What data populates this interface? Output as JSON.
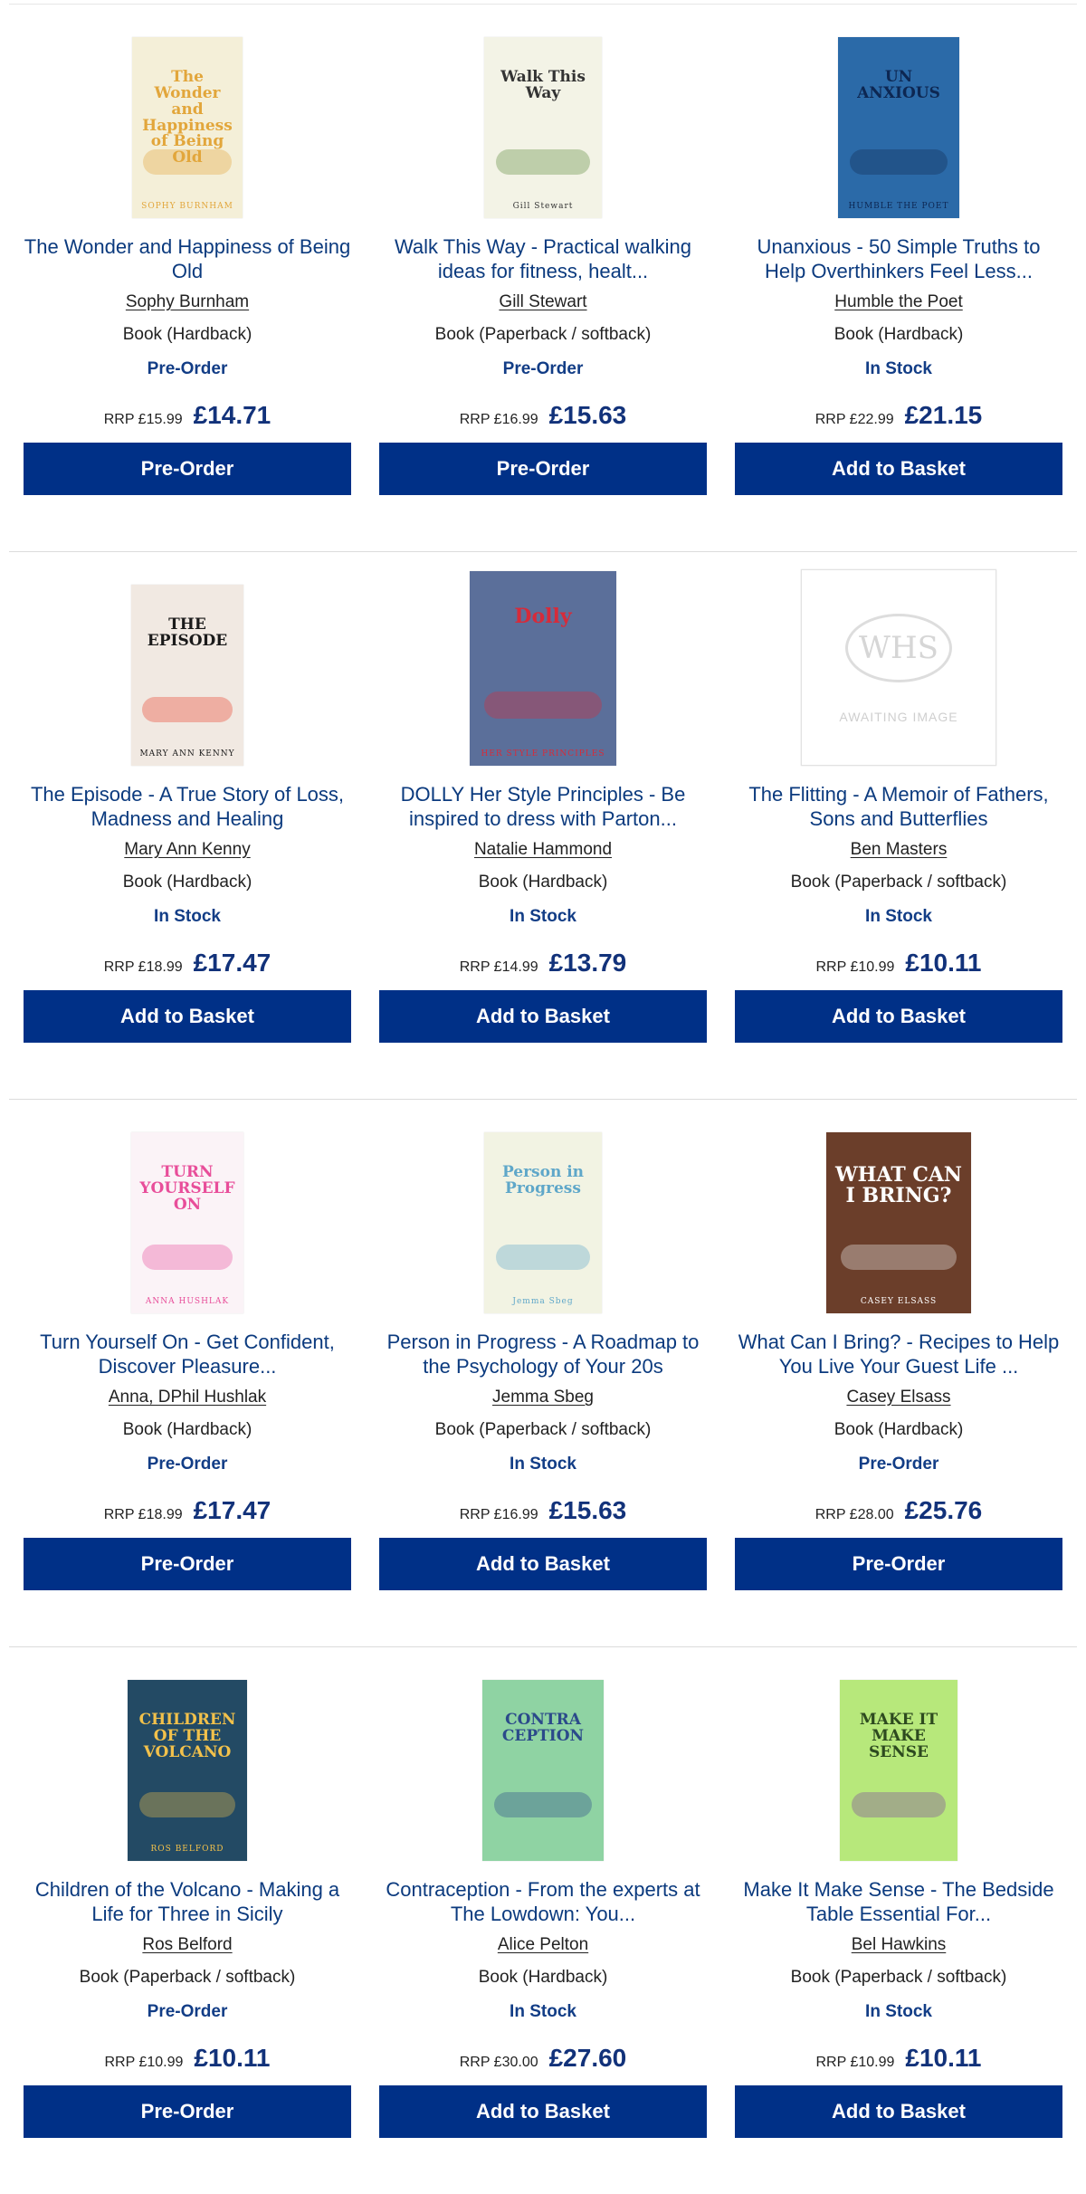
{
  "products": [
    {
      "title": "The Wonder and Happiness of Being Old",
      "author": "Sophy Burnham",
      "format": "Book (Hardback)",
      "status": "Pre-Order",
      "rrp": "RRP £15.99",
      "price": "£14.71",
      "button": "Pre-Order",
      "cover": {
        "bg": "#f4efd8",
        "accent": "#e2a63b",
        "text": "The Wonder and Happiness of Being Old",
        "text_color": "#e2a63b",
        "byline": "SOPHY BURNHAM",
        "w": 122,
        "h": 200
      }
    },
    {
      "title": "Walk This Way - Practical walking ideas for fitness, healt...",
      "author": "Gill Stewart",
      "format": "Book (Paperback / softback)",
      "status": "Pre-Order",
      "rrp": "RRP £16.99",
      "price": "£15.63",
      "button": "Pre-Order",
      "cover": {
        "bg": "#f3f3e6",
        "accent": "#5c8a3a",
        "text": "Walk This Way",
        "text_color": "#333333",
        "byline": "Gill Stewart",
        "w": 130,
        "h": 200
      }
    },
    {
      "title": "Unanxious - 50 Simple Truths to Help Overthinkers Feel Less...",
      "author": "Humble the Poet",
      "format": "Book (Hardback)",
      "status": "In Stock",
      "rrp": "RRP £22.99",
      "price": "£21.15",
      "button": "Add to Basket",
      "cover": {
        "bg": "#2b6aa8",
        "accent": "#102b52",
        "text": "UN ANXIOUS",
        "text_color": "#0d2752",
        "byline": "HUMBLE THE POET",
        "w": 134,
        "h": 200
      }
    },
    {
      "title": "The Episode - A True Story of Loss, Madness and Healing",
      "author": "Mary Ann Kenny",
      "format": "Book (Hardback)",
      "status": "In Stock",
      "rrp": "RRP £18.99",
      "price": "£17.47",
      "button": "Add to Basket",
      "cover": {
        "bg": "#f1e9e2",
        "accent": "#e8432c",
        "text": "THE EPISODE",
        "text_color": "#1a1a1a",
        "byline": "MARY ANN KENNY",
        "w": 124,
        "h": 200
      }
    },
    {
      "title": "DOLLY Her Style Principles - Be inspired to dress with Parton...",
      "author": "Natalie Hammond",
      "format": "Book (Hardback)",
      "status": "In Stock",
      "rrp": "RRP £14.99",
      "price": "£13.79",
      "button": "Add to Basket",
      "cover": {
        "bg": "#5b6f9a",
        "accent": "#d62b3a",
        "text": "Dolly",
        "text_color": "#d62b3a",
        "byline": "HER STYLE PRINCIPLES",
        "w": 162,
        "h": 215
      }
    },
    {
      "title": "The Flitting - A Memoir of Fathers, Sons and Butterflies",
      "author": "Ben Masters",
      "format": "Book (Paperback / softback)",
      "status": "In Stock",
      "rrp": "RRP £10.99",
      "price": "£10.11",
      "button": "Add to Basket",
      "cover": {
        "awaiting": true,
        "logo": "WHS",
        "label": "AWAITING IMAGE",
        "w": 214,
        "h": 215
      }
    },
    {
      "title": "Turn Yourself On - Get Confident, Discover Pleasure...",
      "author": "Anna, DPhil Hushlak",
      "format": "Book (Hardback)",
      "status": "Pre-Order",
      "rrp": "RRP £18.99",
      "price": "£17.47",
      "button": "Pre-Order",
      "cover": {
        "bg": "#fbf3f7",
        "accent": "#e84e9a",
        "text": "TURN YOURSELF ON",
        "text_color": "#e84e9a",
        "byline": "ANNA HUSHLAK",
        "w": 124,
        "h": 200
      }
    },
    {
      "title": "Person in Progress - A Roadmap to the Psychology of Your 20s",
      "author": "Jemma Sbeg",
      "format": "Book (Paperback / softback)",
      "status": "In Stock",
      "rrp": "RRP £16.99",
      "price": "£15.63",
      "button": "Add to Basket",
      "cover": {
        "bg": "#f2f3e3",
        "accent": "#5fa7c9",
        "text": "Person in Progress",
        "text_color": "#5fa7c9",
        "byline": "Jemma Sbeg",
        "w": 130,
        "h": 200
      }
    },
    {
      "title": "What Can I Bring? - Recipes to Help You Live Your Guest Life ...",
      "author": "Casey Elsass",
      "format": "Book (Hardback)",
      "status": "Pre-Order",
      "rrp": "RRP £28.00",
      "price": "£25.76",
      "button": "Pre-Order",
      "cover": {
        "bg": "#6b3e2a",
        "accent": "#f2f2f2",
        "text": "WHAT CAN I BRING?",
        "text_color": "#ffffff",
        "byline": "CASEY ELSASS",
        "w": 160,
        "h": 200
      }
    },
    {
      "title": "Children of the Volcano - Making a Life for Three in Sicily",
      "author": "Ros Belford",
      "format": "Book (Paperback / softback)",
      "status": "Pre-Order",
      "rrp": "RRP £10.99",
      "price": "£10.11",
      "button": "Pre-Order",
      "cover": {
        "bg": "#234a64",
        "accent": "#f2c14b",
        "text": "CHILDREN OF THE VOLCANO",
        "text_color": "#f2c14b",
        "byline": "ROS BELFORD",
        "w": 132,
        "h": 200
      }
    },
    {
      "title": "Contraception - From the experts at The Lowdown: You...",
      "author": "Alice Pelton",
      "format": "Book (Hardback)",
      "status": "In Stock",
      "rrp": "RRP £30.00",
      "price": "£27.60",
      "button": "Add to Basket",
      "cover": {
        "bg": "#8fd3a3",
        "accent": "#2b4a8a",
        "text": "CONTRA CEPTION",
        "text_color": "#2b4a8a",
        "byline": "",
        "w": 134,
        "h": 200
      }
    },
    {
      "title": "Make It Make Sense - The Bedside Table Essential For...",
      "author": "Bel Hawkins",
      "format": "Book (Paperback / softback)",
      "status": "In Stock",
      "rrp": "RRP £10.99",
      "price": "£10.11",
      "button": "Add to Basket",
      "cover": {
        "bg": "#b7e87b",
        "accent": "#7a3fa0",
        "text": "MAKE IT MAKE SENSE",
        "text_color": "#2d4a1f",
        "byline": "",
        "w": 130,
        "h": 200
      }
    }
  ]
}
